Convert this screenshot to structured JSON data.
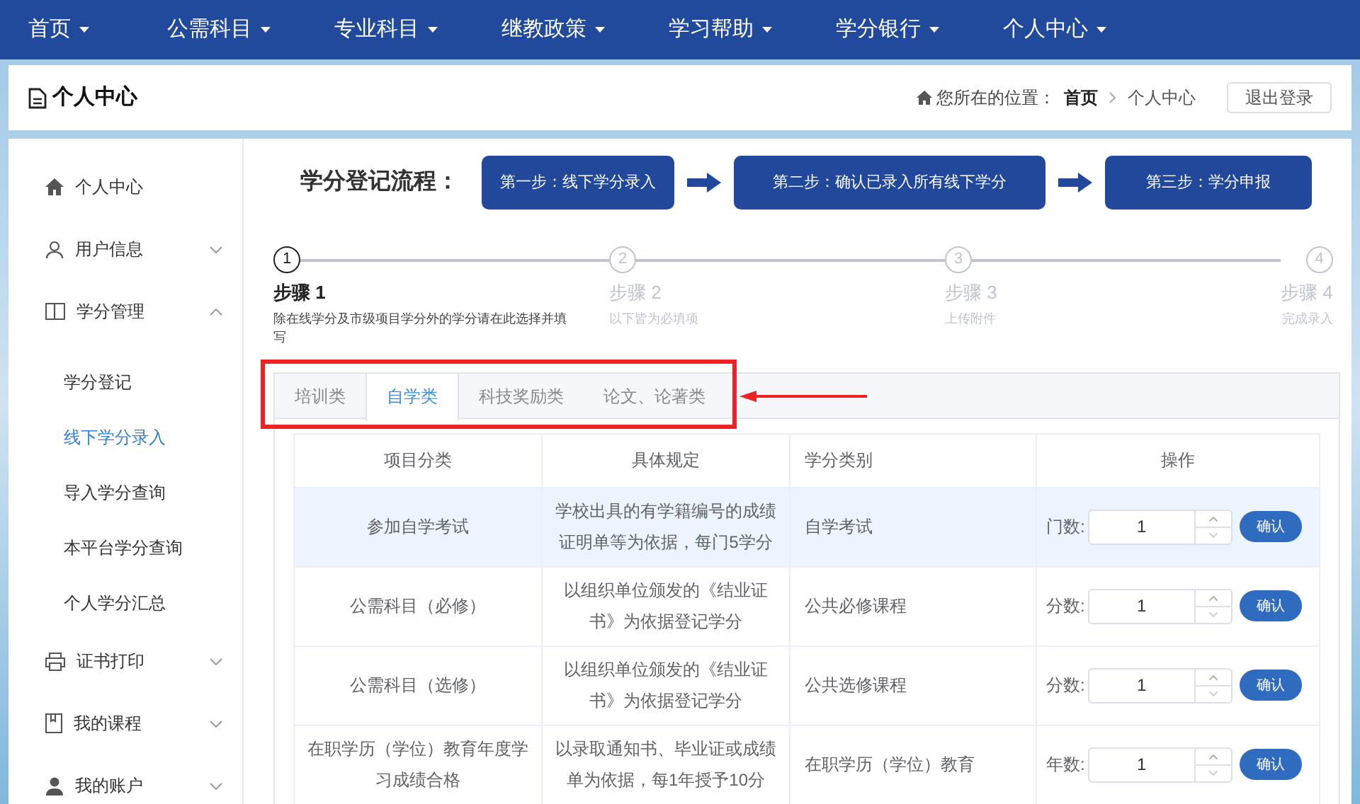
{
  "nav": [
    {
      "label": "首页"
    },
    {
      "label": "公需科目"
    },
    {
      "label": "专业科目"
    },
    {
      "label": "继教政策"
    },
    {
      "label": "学习帮助"
    },
    {
      "label": "学分银行"
    },
    {
      "label": "个人中心"
    }
  ],
  "header": {
    "title": "个人中心",
    "breadcrumb_prefix": "您所在的位置：",
    "breadcrumb": [
      "首页",
      "个人中心"
    ],
    "logout": "退出登录"
  },
  "sidebar": [
    {
      "label": "个人中心",
      "kind": "link"
    },
    {
      "label": "用户信息",
      "kind": "group",
      "expanded": false
    },
    {
      "label": "学分管理",
      "kind": "group",
      "expanded": true,
      "children": [
        {
          "label": "学分登记",
          "selected": false
        },
        {
          "label": "线下学分录入",
          "selected": true
        },
        {
          "label": "导入学分查询",
          "selected": false
        },
        {
          "label": "本平台学分查询",
          "selected": false
        },
        {
          "label": "个人学分汇总",
          "selected": false
        }
      ]
    },
    {
      "label": "证书打印",
      "kind": "group",
      "expanded": false
    },
    {
      "label": "我的课程",
      "kind": "group",
      "expanded": false
    },
    {
      "label": "我的账户",
      "kind": "group",
      "expanded": false
    }
  ],
  "flow": {
    "title": "学分登记流程：",
    "steps": [
      "第一步：线下学分录入",
      "第二步：确认已录入所有线下学分",
      "第三步：学分申报"
    ]
  },
  "steps": [
    {
      "number": "1",
      "title": "步骤 1",
      "description": "除在线学分及市级项目学分外的学分请在此选择并填写",
      "selected": true
    },
    {
      "number": "2",
      "title": "步骤 2",
      "description": "以下皆为必填项",
      "selected": false
    },
    {
      "number": "3",
      "title": "步骤 3",
      "description": "上传附件",
      "selected": false
    },
    {
      "number": "4",
      "title": "步骤 4",
      "description": "完成录入",
      "selected": false
    }
  ],
  "tabs": [
    {
      "label": "培训类",
      "selected": false
    },
    {
      "label": "自学类",
      "selected": true
    },
    {
      "label": "科技奖励类",
      "selected": false
    },
    {
      "label": "论文、论著类",
      "selected": false
    }
  ],
  "table": {
    "columns": [
      "项目分类",
      "具体规定",
      "学分类别",
      "操作"
    ],
    "rows": [
      {
        "category": "参加自学考试",
        "rule": "学校出具的有学籍编号的成绩证明单等为依据，每门5学分",
        "credit_type": "自学考试",
        "field_label": "门数:",
        "value": "1",
        "button": "确认",
        "selected": true
      },
      {
        "category": "公需科目（必修）",
        "rule": "以组织单位颁发的《结业证书》为依据登记学分",
        "credit_type": "公共必修课程",
        "field_label": "分数:",
        "value": "1",
        "button": "确认",
        "selected": false
      },
      {
        "category": "公需科目（选修）",
        "rule": "以组织单位颁发的《结业证书》为依据登记学分",
        "credit_type": "公共选修课程",
        "field_label": "分数:",
        "value": "1",
        "button": "确认",
        "selected": false
      },
      {
        "category": "在职学历（学位）教育年度学习成绩合格",
        "rule": "以录取通知书、毕业证或成绩单为依据，每1年授予10分",
        "credit_type": "在职学历（学位）教育",
        "field_label": "年数:",
        "value": "1",
        "button": "确认",
        "selected": false
      }
    ]
  }
}
